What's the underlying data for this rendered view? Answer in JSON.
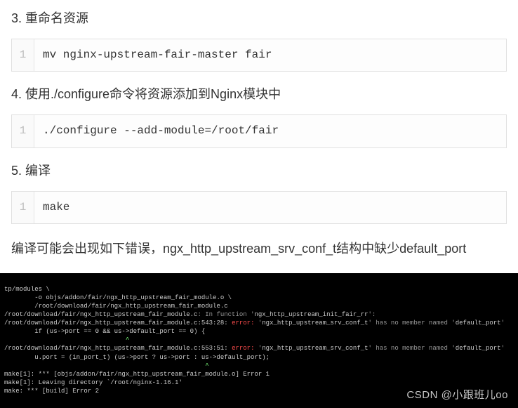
{
  "sections": [
    {
      "title": "3. 重命名资源",
      "code": "mv nginx-upstream-fair-master fair"
    },
    {
      "title": "4. 使用./configure命令将资源添加到Nginx模块中",
      "code": "./configure --add-module=/root/fair"
    },
    {
      "title": "5. 编译",
      "code": "make"
    }
  ],
  "paragraph": "编译可能会出现如下错误，ngx_http_upstream_srv_conf_t结构中缺少default_port",
  "terminal": {
    "line1": "tp/modules \\",
    "line2": "        -o objs/addon/fair/ngx_http_upstream_fair_module.o \\",
    "line3": "        /root/download/fair/ngx_http_upstream_fair_module.c",
    "line4a": "/root/download/fair/ngx_http_upstream_fair_module.c",
    "line4b": ": In function '",
    "line4c": "ngx_http_upstream_init_fair_rr",
    "line4d": "':",
    "line5a": "/root/download/fair/ngx_http_upstream_fair_module.c:543:28: ",
    "line5b": "error: ",
    "line5c": "'",
    "line5d": "ngx_http_upstream_srv_conf_t",
    "line5e": "' has no member named '",
    "line5f": "default_port",
    "line5g": "'",
    "line6": "        if (us->port == 0 && us->default_port == 0) {",
    "line7": "                                ^",
    "line8a": "/root/download/fair/ngx_http_upstream_fair_module.c:553:51: ",
    "line8b": "error: ",
    "line8c": "'",
    "line8d": "ngx_http_upstream_srv_conf_t",
    "line8e": "' has no member named '",
    "line8f": "default_port",
    "line8g": "'",
    "line9": "        u.port = (in_port_t) (us->port ? us->port : us->default_port);",
    "line10": "                                                     ^",
    "line11": "make[1]: *** [objs/addon/fair/ngx_http_upstream_fair_module.o] Error 1",
    "line12": "make[1]: Leaving directory `/root/nginx-1.16.1'",
    "line13": "make: *** [build] Error 2"
  },
  "watermark": "CSDN @小跟班儿oo",
  "lineNumber": "1"
}
